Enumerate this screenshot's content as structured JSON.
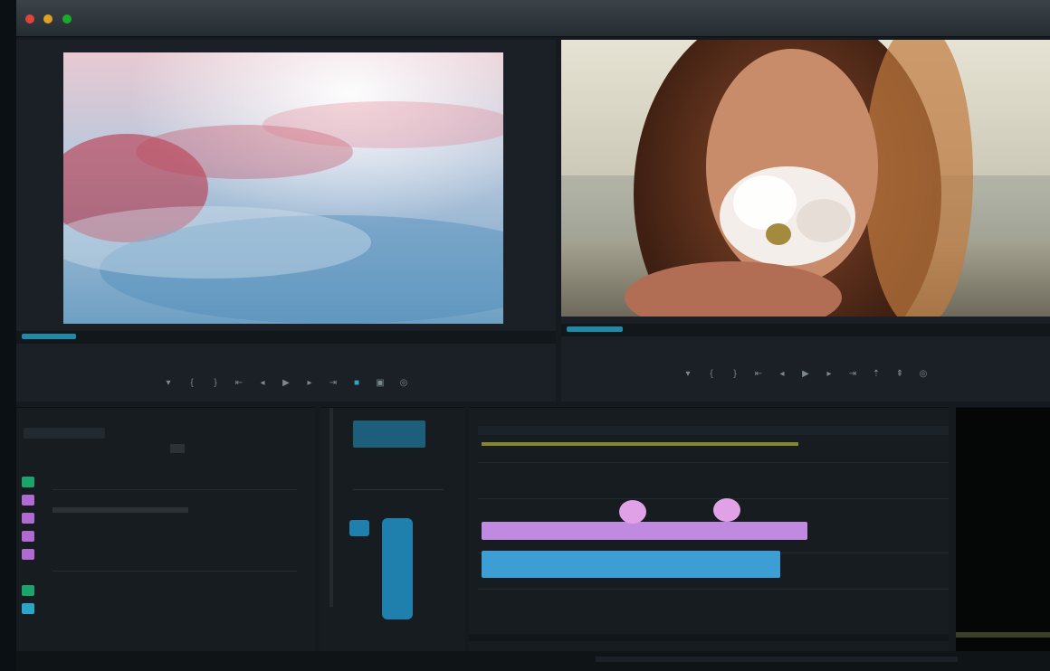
{
  "window": {
    "title": "",
    "traffic_colors": [
      "#e0443e",
      "#dea123",
      "#1aab29"
    ]
  },
  "source_monitor": {
    "tab_label": "",
    "timecode": "",
    "duration": "",
    "transport": [
      "add-marker",
      "mark-in",
      "mark-out",
      "go-to-in",
      "step-back",
      "play",
      "step-forward",
      "go-to-out",
      "insert",
      "overwrite",
      "export-frame"
    ]
  },
  "program_monitor": {
    "tab_label": "",
    "timecode": "",
    "duration": "",
    "transport": [
      "add-marker",
      "mark-in",
      "mark-out",
      "go-to-in",
      "step-back",
      "play",
      "step-forward",
      "go-to-out",
      "lift",
      "extract",
      "export-frame"
    ]
  },
  "project_panel": {
    "tab_label": "",
    "items": [
      "",
      "",
      "",
      "",
      "",
      "",
      ""
    ]
  },
  "tools_panel": {
    "tab_label": ""
  },
  "timeline": {
    "tab_label": "",
    "tracks": [
      "",
      "",
      "",
      "",
      ""
    ]
  },
  "colors": {
    "accent": "#2aa7c7",
    "video_clip": "#c08ae0",
    "audio_clip": "#3d9ed6",
    "work_area": "#b5b632",
    "panel_bg": "#171c20"
  }
}
